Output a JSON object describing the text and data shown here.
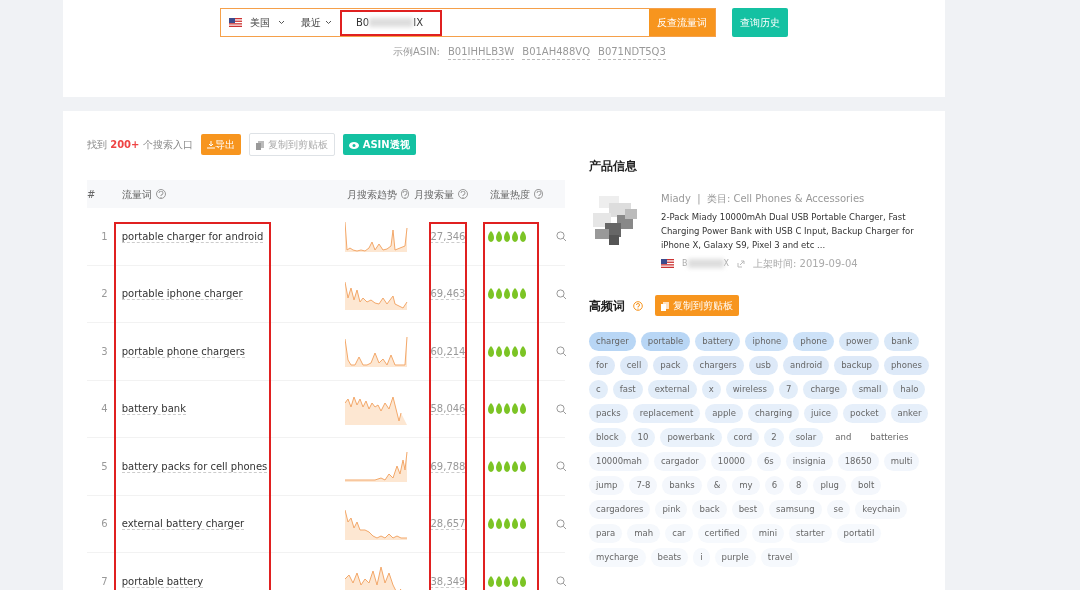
{
  "search": {
    "country": "美国",
    "range": "最近",
    "asin_prefix": "B0",
    "asin_suffix": "IX",
    "highlighted": true,
    "submit": "反查流量词",
    "history": "查询历史",
    "example_label": "示例ASIN:",
    "examples": [
      "B01IHHLB3W",
      "B01AH488VQ",
      "B071NDT5Q3"
    ]
  },
  "toolbar": {
    "found_prefix": "找到",
    "found_count": "200+",
    "found_suffix": "个搜索入口",
    "export": "导出",
    "copy": "复制到剪贴板",
    "asin_view": "ASIN透视"
  },
  "table": {
    "columns": [
      {
        "label": "#",
        "help": false,
        "highlighted": false
      },
      {
        "label": "流量词",
        "help": true,
        "highlighted": true
      },
      {
        "label": "月搜索趋势",
        "help": true,
        "highlighted": false
      },
      {
        "label": "月搜索量",
        "help": true,
        "highlighted": true
      },
      {
        "label": "流量热度",
        "help": true,
        "highlighted": true
      }
    ],
    "rows": [
      {
        "index": "1",
        "keyword": "portable charger for android",
        "volume": "27,346",
        "stars": 5
      },
      {
        "index": "2",
        "keyword": "portable iphone charger",
        "volume": "69,463",
        "stars": 5
      },
      {
        "index": "3",
        "keyword": "portable phone chargers",
        "volume": "60,214",
        "stars": 5
      },
      {
        "index": "4",
        "keyword": "battery bank",
        "volume": "58,046",
        "stars": 5
      },
      {
        "index": "5",
        "keyword": "battery packs for cell phones",
        "volume": "69,788",
        "stars": 5
      },
      {
        "index": "6",
        "keyword": "external battery charger",
        "volume": "28,657",
        "stars": 5
      },
      {
        "index": "7",
        "keyword": "portable battery",
        "volume": "38,349",
        "stars": 5
      }
    ]
  },
  "product": {
    "heading": "产品信息",
    "brand": "Miady",
    "separator": "|",
    "category_label": "类目:",
    "category": "Cell Phones & Accessories",
    "title": "2-Pack Miady 10000mAh Dual USB Portable Charger, Fast Charging Power Bank with USB C Input, Backup Charger for iPhone X, Galaxy S9, Pixel 3 and etc ...",
    "asin_prefix": "B",
    "asin_suffix": "X",
    "listed": "上架时间: 2019-09-04"
  },
  "keywords": {
    "heading": "高频词",
    "copy": "复制到剪贴板",
    "tags": [
      {
        "text": "charger",
        "color": "#b8d6f5"
      },
      {
        "text": "portable",
        "color": "#b8d6f5"
      },
      {
        "text": "battery",
        "color": "#cde2f8"
      },
      {
        "text": "iphone",
        "color": "#cde2f8"
      },
      {
        "text": "phone",
        "color": "#cde2f8"
      },
      {
        "text": "power",
        "color": "#d9e8f8"
      },
      {
        "text": "bank",
        "color": "#d9e8f8"
      },
      {
        "text": "for",
        "color": "#dde9f8"
      },
      {
        "text": "cell",
        "color": "#dde9f8"
      },
      {
        "text": "pack",
        "color": "#dde9f8"
      },
      {
        "text": "chargers",
        "color": "#dde9f8"
      },
      {
        "text": "usb",
        "color": "#dde9f8"
      },
      {
        "text": "android",
        "color": "#dde9f8"
      },
      {
        "text": "backup",
        "color": "#dde9f8"
      },
      {
        "text": "phones",
        "color": "#dde9f8"
      },
      {
        "text": "c",
        "color": "#e2edf9"
      },
      {
        "text": "fast",
        "color": "#e2edf9"
      },
      {
        "text": "external",
        "color": "#e2edf9"
      },
      {
        "text": "x",
        "color": "#e2edf9"
      },
      {
        "text": "wireless",
        "color": "#e2edf9"
      },
      {
        "text": "7",
        "color": "#e2edf9"
      },
      {
        "text": "charge",
        "color": "#e2edf9"
      },
      {
        "text": "small",
        "color": "#e2edf9"
      },
      {
        "text": "halo",
        "color": "#e2edf9"
      },
      {
        "text": "packs",
        "color": "#e6effa"
      },
      {
        "text": "replacement",
        "color": "#e6effa"
      },
      {
        "text": "apple",
        "color": "#e6effa"
      },
      {
        "text": "charging",
        "color": "#e6effa"
      },
      {
        "text": "juice",
        "color": "#e6effa"
      },
      {
        "text": "pocket",
        "color": "#e6effa"
      },
      {
        "text": "anker",
        "color": "#e6effa"
      },
      {
        "text": "block",
        "color": "#eaf2fb"
      },
      {
        "text": "10",
        "color": "#eaf2fb"
      },
      {
        "text": "powerbank",
        "color": "#eaf2fb"
      },
      {
        "text": "cord",
        "color": "#eaf2fb"
      },
      {
        "text": "2",
        "color": "#eaf2fb"
      },
      {
        "text": "solar",
        "color": "#eaf2fb"
      },
      {
        "text": "and",
        "color": "#ffffff"
      },
      {
        "text": "batteries",
        "color": "#ffffff"
      },
      {
        "text": "10000mah",
        "color": "#f2f6fc"
      },
      {
        "text": "cargador",
        "color": "#f2f6fc"
      },
      {
        "text": "10000",
        "color": "#f2f6fc"
      },
      {
        "text": "6s",
        "color": "#f2f6fc"
      },
      {
        "text": "insignia",
        "color": "#f2f6fc"
      },
      {
        "text": "18650",
        "color": "#f2f6fc"
      },
      {
        "text": "multi",
        "color": "#f2f6fc"
      },
      {
        "text": "jump",
        "color": "#f4f7fc"
      },
      {
        "text": "7-8",
        "color": "#f4f7fc"
      },
      {
        "text": "banks",
        "color": "#f4f7fc"
      },
      {
        "text": "&",
        "color": "#f4f7fc"
      },
      {
        "text": "my",
        "color": "#f4f7fc"
      },
      {
        "text": "6",
        "color": "#f4f7fc"
      },
      {
        "text": "8",
        "color": "#f4f7fc"
      },
      {
        "text": "plug",
        "color": "#f4f7fc"
      },
      {
        "text": "bolt",
        "color": "#f4f7fc"
      },
      {
        "text": "cargadores",
        "color": "#f4f7fc"
      },
      {
        "text": "pink",
        "color": "#f5f8fc"
      },
      {
        "text": "back",
        "color": "#f5f8fc"
      },
      {
        "text": "best",
        "color": "#f5f8fc"
      },
      {
        "text": "samsung",
        "color": "#f5f8fc"
      },
      {
        "text": "se",
        "color": "#f5f8fc"
      },
      {
        "text": "keychain",
        "color": "#f5f8fc"
      },
      {
        "text": "para",
        "color": "#f5f8fc"
      },
      {
        "text": "mah",
        "color": "#f5f8fc"
      },
      {
        "text": "car",
        "color": "#f6f9fd"
      },
      {
        "text": "certified",
        "color": "#f6f9fd"
      },
      {
        "text": "mini",
        "color": "#f6f9fd"
      },
      {
        "text": "starter",
        "color": "#f6f9fd"
      },
      {
        "text": "portatil",
        "color": "#f6f9fd"
      },
      {
        "text": "mycharge",
        "color": "#f6f9fd"
      },
      {
        "text": "beats",
        "color": "#f6f9fd"
      },
      {
        "text": "i",
        "color": "#f6f9fd"
      },
      {
        "text": "purple",
        "color": "#f6f9fd"
      },
      {
        "text": "travel",
        "color": "#f6f9fd"
      }
    ]
  }
}
